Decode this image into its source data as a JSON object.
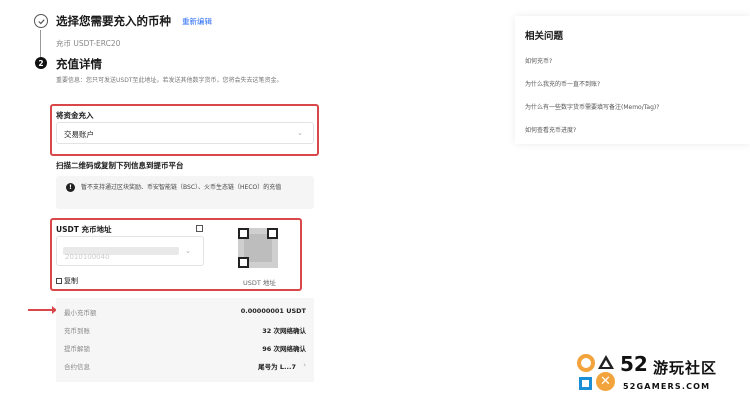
{
  "step1": {
    "title": "选择您需要充入的币种",
    "reedit": "重新编辑",
    "subtitle": "充币 USDT-ERC20"
  },
  "step2": {
    "number": "2",
    "title": "充值详情",
    "notice": "重要信息：您只可发送USDT至此地址。若发送其他数字货币，您将会失去这笔资金。"
  },
  "transfer": {
    "label": "将资金充入",
    "selected": "交易账户"
  },
  "scan": {
    "title": "扫描二维码或复制下列信息到提币平台"
  },
  "warning": {
    "icon": "!",
    "text": "暂不支持通过区块奖励、币安智能链（BSC）、火币生态链（HECO）的充值"
  },
  "address": {
    "title": "USDT 充币地址",
    "value": "2010100040",
    "copy_label": "复制",
    "qr_label": "USDT 地址"
  },
  "info": [
    {
      "key": "最小充币额",
      "value": "0.00000001 USDT"
    },
    {
      "key": "充币到账",
      "value": "32 次网络确认"
    },
    {
      "key": "提币解锁",
      "value": "96 次网络确认"
    },
    {
      "key": "合约信息",
      "value": "尾号为 L...7"
    }
  ],
  "faq": {
    "title": "相关问题",
    "items": [
      "如何充币?",
      "为什么我充的币一直不到账?",
      "为什么有一些数字货币需要填写备注(Memo/Tag)?",
      "如何查看充币进度?"
    ]
  },
  "logo": {
    "number": "52",
    "name": "游玩社区",
    "domain": "52GAMERS.COM"
  },
  "colors": {
    "highlight": "#d9474b",
    "link": "#2a6df5"
  },
  "icons": [
    "check-circle-icon",
    "chevron-down-icon",
    "info-icon",
    "copy-icon",
    "qr-code-icon"
  ]
}
